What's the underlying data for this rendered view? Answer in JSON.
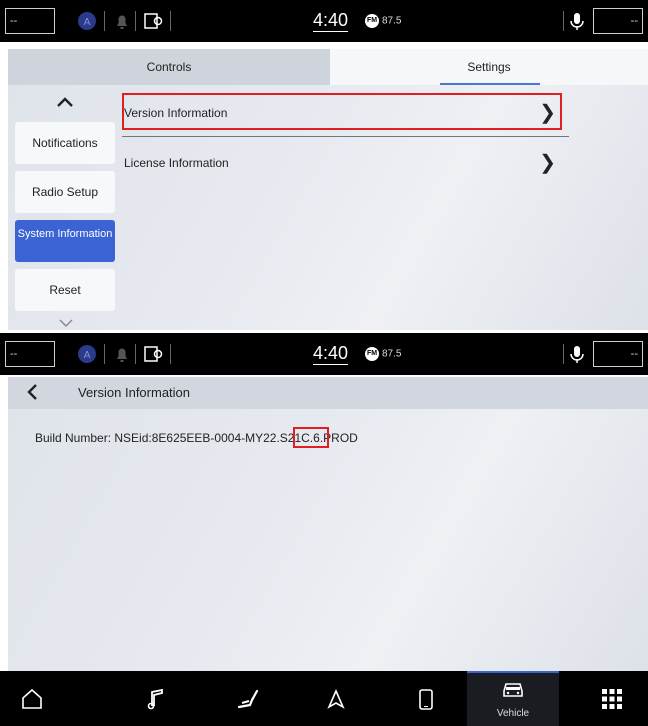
{
  "status_bar": {
    "left_value": "--",
    "right_value": "--",
    "time": "4:40",
    "radio_band": "FM",
    "radio_freq": "87.5"
  },
  "settings_screen": {
    "tabs": [
      {
        "label": "Controls",
        "active": false
      },
      {
        "label": "Settings",
        "active": true
      }
    ],
    "sidebar": [
      {
        "label": "Notifications",
        "active": false
      },
      {
        "label": "Radio Setup",
        "active": false
      },
      {
        "label": "System Information",
        "active": true
      },
      {
        "label": "Reset",
        "active": false
      }
    ],
    "rows": [
      {
        "label": "Version Information"
      },
      {
        "label": "License Information"
      }
    ]
  },
  "version_screen": {
    "title": "Version Information",
    "build_prefix": "Build Number: NSEid:8E625EEB-0004-MY22.S",
    "build_highlight": "21C.6",
    "build_suffix": ".PROD"
  },
  "nav_bar": {
    "items": [
      {
        "icon": "home-icon"
      },
      {
        "icon": "music-icon"
      },
      {
        "icon": "seat-icon"
      },
      {
        "icon": "navigation-icon"
      },
      {
        "icon": "phone-icon"
      },
      {
        "icon": "vehicle-icon",
        "label": "Vehicle",
        "active": true
      },
      {
        "icon": "apps-grid-icon"
      }
    ]
  },
  "colors": {
    "accent": "#3c63d3",
    "highlight": "#e02020",
    "bar": "#000000"
  }
}
